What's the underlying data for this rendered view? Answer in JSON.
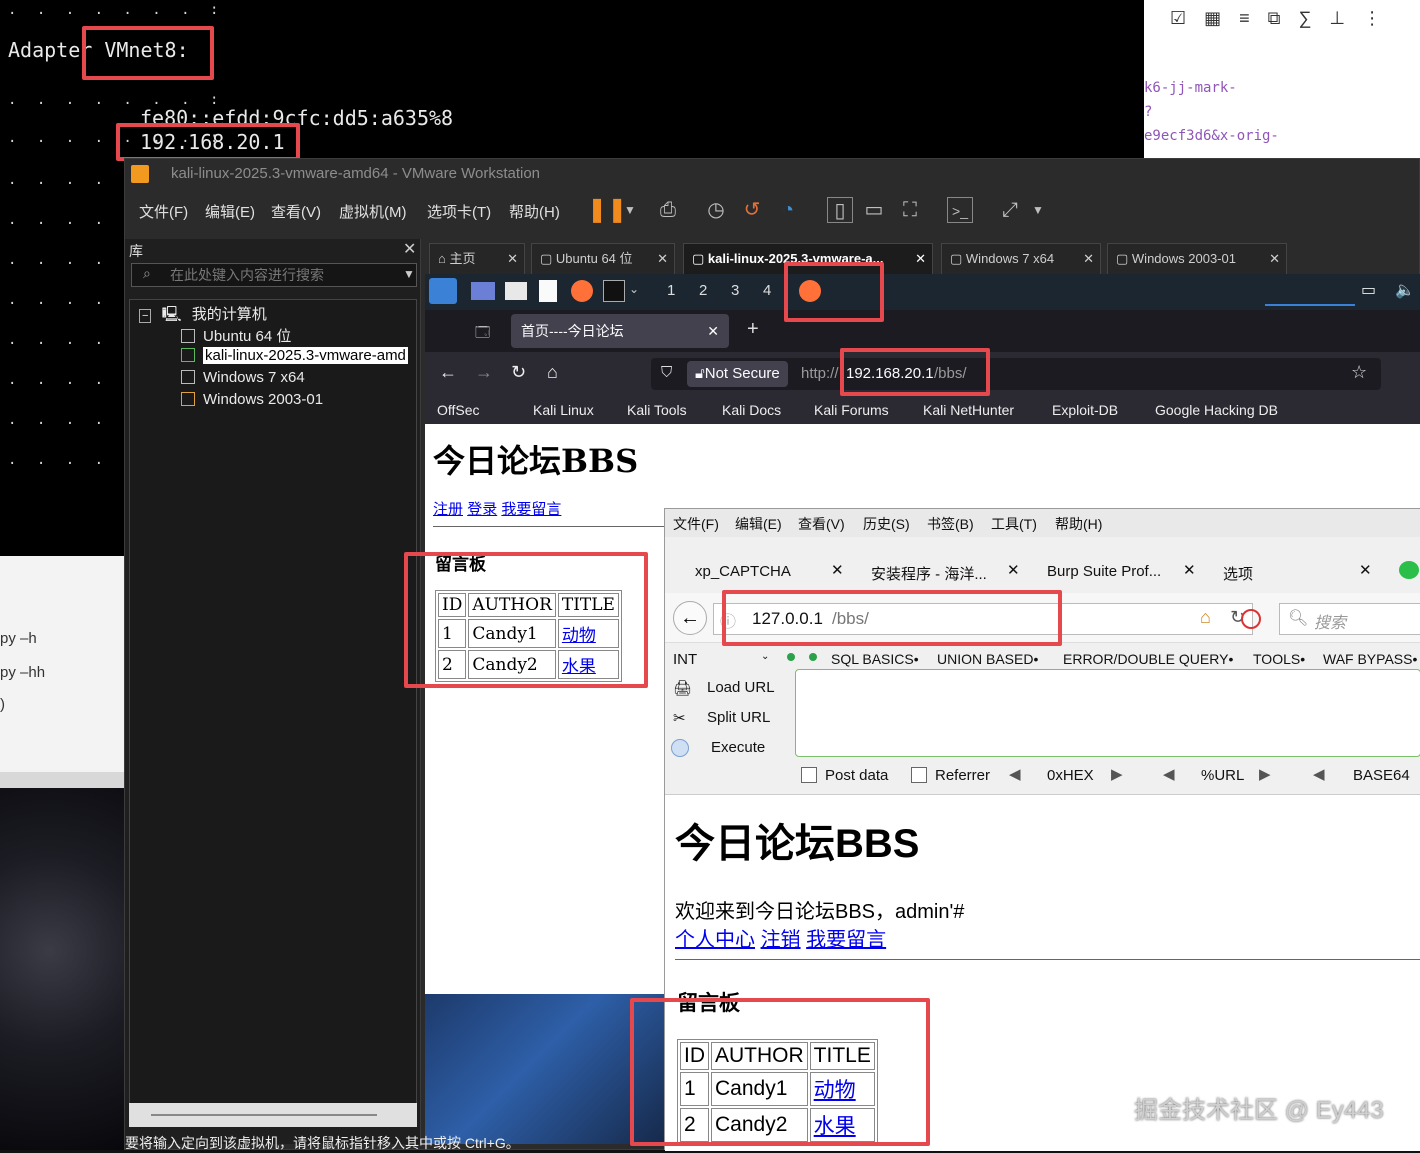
{
  "terminal": {
    "adapter_label": "Adapter VMnet8:",
    "ipv6": "fe80::efdd:9cfc:dd5:a635%8",
    "ipv4": "192.168.20.1"
  },
  "blog_fragment": {
    "code_lines": [
      "k6-jj-mark-",
      "?",
      "e9ecf3d6&x-orig-"
    ]
  },
  "left_fragment": {
    "lines": [
      "py –h",
      "py –hh",
      ")"
    ]
  },
  "vmware": {
    "title": "kali-linux-2025.3-vmware-amd64 - VMware Workstation",
    "menu": [
      "文件(F)",
      "编辑(E)",
      "查看(V)",
      "虚拟机(M)",
      "选项卡(T)",
      "帮助(H)"
    ],
    "library": {
      "title": "库",
      "search_placeholder": "在此处键入内容进行搜索",
      "root": "我的计算机",
      "vms": [
        "Ubuntu 64 位",
        "kali-linux-2025.3-vmware-amd",
        "Windows 7 x64",
        "Windows  2003-01"
      ]
    },
    "tabs": [
      {
        "label": "主页"
      },
      {
        "label": "Ubuntu 64 位"
      },
      {
        "label": "kali-linux-2025.3-vmware-a..."
      },
      {
        "label": "Windows 7 x64"
      },
      {
        "label": "Windows  2003-01"
      }
    ],
    "status_bar": "要将输入定向到该虚拟机，请将鼠标指针移入其中或按 Ctrl+G。"
  },
  "kali": {
    "workspaces": [
      "1",
      "2",
      "3",
      "4"
    ],
    "firefox": {
      "tab_title": "首页----今日论坛",
      "not_secure": "Not Secure",
      "url_prefix": "http://",
      "url_host": "192.168.20.1",
      "url_path": "/bbs/",
      "bookmarks": [
        "OffSec",
        "Kali Linux",
        "Kali Tools",
        "Kali Docs",
        "Kali Forums",
        "Kali NetHunter",
        "Exploit-DB",
        "Google Hacking DB"
      ]
    },
    "page": {
      "heading": "今日论坛BBS",
      "links": [
        "注册",
        "登录",
        "我要留言"
      ],
      "board_title": "留言板",
      "table_headers": [
        "ID",
        "AUTHOR",
        "TITLE"
      ],
      "rows": [
        {
          "id": "1",
          "author": "Candy1",
          "title": "动物"
        },
        {
          "id": "2",
          "author": "Candy2",
          "title": "水果"
        }
      ]
    }
  },
  "xp_browser": {
    "menu": [
      "文件(F)",
      "编辑(E)",
      "查看(V)",
      "历史(S)",
      "书签(B)",
      "工具(T)",
      "帮助(H)"
    ],
    "tabs": [
      "xp_CAPTCHA",
      "安装程序 - 海洋...",
      "Burp Suite Prof...",
      "选项"
    ],
    "url_host": "127.0.0.1",
    "url_path": "/bbs/",
    "search_placeholder": "搜索",
    "hackbar": {
      "select": "INT",
      "menus": [
        "SQL BASICS•",
        "UNION BASED•",
        "ERROR/DOUBLE QUERY•",
        "TOOLS•",
        "WAF BYPASS•"
      ],
      "load_url": "Load URL",
      "split_url": "Split URL",
      "execute": "Execute",
      "post_data": "Post data",
      "referrer": "Referrer",
      "encoders": [
        "0xHEX",
        "%URL",
        "BASE64"
      ]
    },
    "page": {
      "heading": "今日论坛BBS",
      "welcome": "欢迎来到今日论坛BBS，admin'#",
      "links": [
        "个人中心",
        "注销",
        "我要留言"
      ],
      "board_title": "留言板",
      "table_headers": [
        "ID",
        "AUTHOR",
        "TITLE"
      ],
      "rows": [
        {
          "id": "1",
          "author": "Candy1",
          "title": "动物"
        },
        {
          "id": "2",
          "author": "Candy2",
          "title": "水果"
        }
      ]
    }
  },
  "watermark": "掘金技术社区 @ Ey443",
  "colors": {
    "highlight": "#e5484d",
    "link": "#0000ee"
  }
}
